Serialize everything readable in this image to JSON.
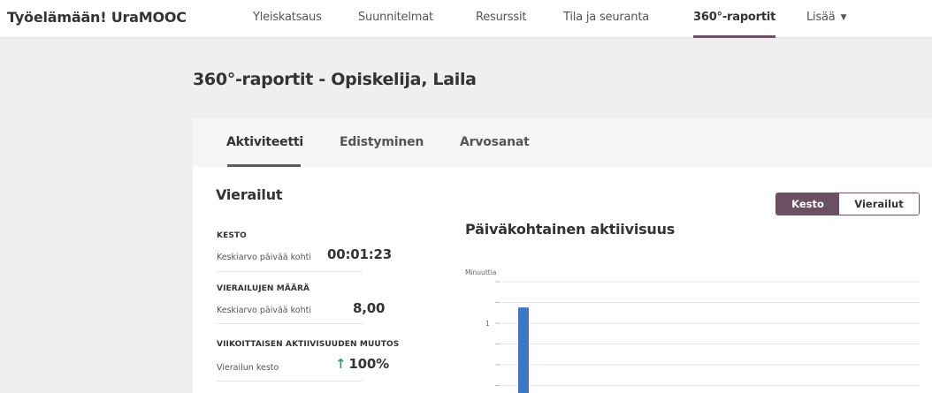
{
  "app": {
    "title": "Työelämään! UraMOOC"
  },
  "nav": {
    "items": [
      {
        "label": "Yleiskatsaus"
      },
      {
        "label": "Suunnitelmat"
      },
      {
        "label": "Resurssit"
      },
      {
        "label": "Tila ja seuranta"
      },
      {
        "label": "360°-raportit",
        "active": true
      },
      {
        "label": "Lisää"
      }
    ],
    "more_caret_icon": "caret-down-icon"
  },
  "page": {
    "title": "360°-raportit - Opiskelija, Laila"
  },
  "tabs": [
    {
      "label": "Aktiviteetti",
      "active": true
    },
    {
      "label": "Edistyminen"
    },
    {
      "label": "Arvosanat"
    }
  ],
  "visits": {
    "title": "Vierailut",
    "stats": [
      {
        "label": "KESTO",
        "sub": "Keskiarvo päivää kohti",
        "value": "00:01:23"
      },
      {
        "label": "VIERAILUJEN MÄÄRÄ",
        "sub": "Keskiarvo päivää kohti",
        "value": "8,00"
      },
      {
        "label": "VIIKOITTAISEN AKTIIVISUUDEN MUUTOS",
        "sub": "Vierailun kesto",
        "value": "100%",
        "trend_icon": "arrow-up-icon",
        "trend_color": "#2f9e67"
      }
    ]
  },
  "toggle": {
    "options": [
      {
        "label": "Kesto",
        "selected": true
      },
      {
        "label": "Vierailut"
      }
    ]
  },
  "colors": {
    "accent": "#6b4f62",
    "bar": "#3a78c4",
    "trend_up": "#2f9e67"
  },
  "chart_data": {
    "type": "bar",
    "title": "Päiväkohtainen aktiivisuus",
    "ylabel": "Minuuttia",
    "yticks": [
      "1"
    ],
    "series": [
      {
        "values": [
          1.38
        ]
      }
    ],
    "grid": true
  }
}
